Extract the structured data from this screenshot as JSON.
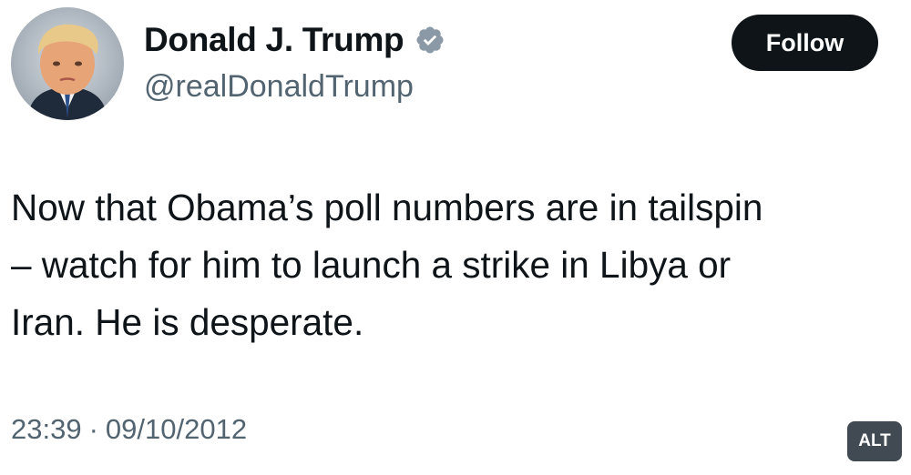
{
  "author": {
    "display_name": "Donald J. Trump",
    "handle": "@realDonaldTrump",
    "verified_icon": "verified-badge-icon",
    "avatar_icon": "profile-photo"
  },
  "follow_button": {
    "label": "Follow"
  },
  "tweet": {
    "lines": [
      "Now that Obama’s poll numbers are in tailspin",
      "– watch for him to launch a strike in Libya or",
      "Iran.  He is desperate."
    ]
  },
  "meta": {
    "time": "23:39",
    "separator": "·",
    "date": "09/10/2012"
  },
  "alt_badge": {
    "label": "ALT"
  },
  "colors": {
    "text": "#0f1419",
    "secondary": "#536471",
    "follow_bg": "#0f1419",
    "alt_bg": "#414a52",
    "verified": "#8b98a5"
  }
}
